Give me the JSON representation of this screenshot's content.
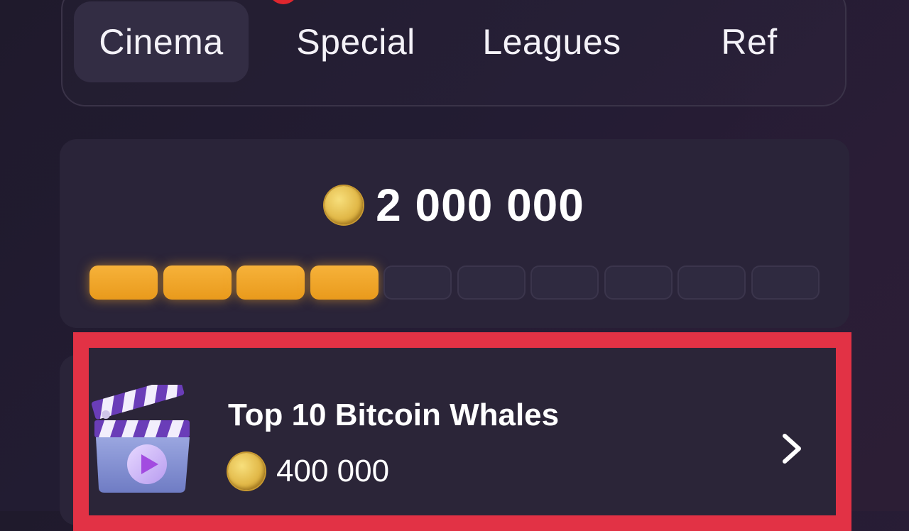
{
  "tabs": [
    {
      "label": "Cinema",
      "active": true,
      "notification": true
    },
    {
      "label": "Special",
      "active": false
    },
    {
      "label": "Leagues",
      "active": false
    },
    {
      "label": "Ref",
      "active": false
    }
  ],
  "reward": {
    "icon": "coin-icon",
    "value": "2 000 000",
    "progress": {
      "filled": 4,
      "total": 10
    }
  },
  "task": {
    "icon": "clapperboard-icon",
    "title": "Top 10 Bitcoin Whales",
    "reward": "400 000",
    "action_icon": "chevron-right-icon"
  },
  "colors": {
    "background": "#231c33",
    "card": "#2a2439",
    "active_tab": "#332d44",
    "progress_on": "#f0a52a",
    "highlight_border": "#e23245",
    "notification_dot": "#e0262e"
  }
}
